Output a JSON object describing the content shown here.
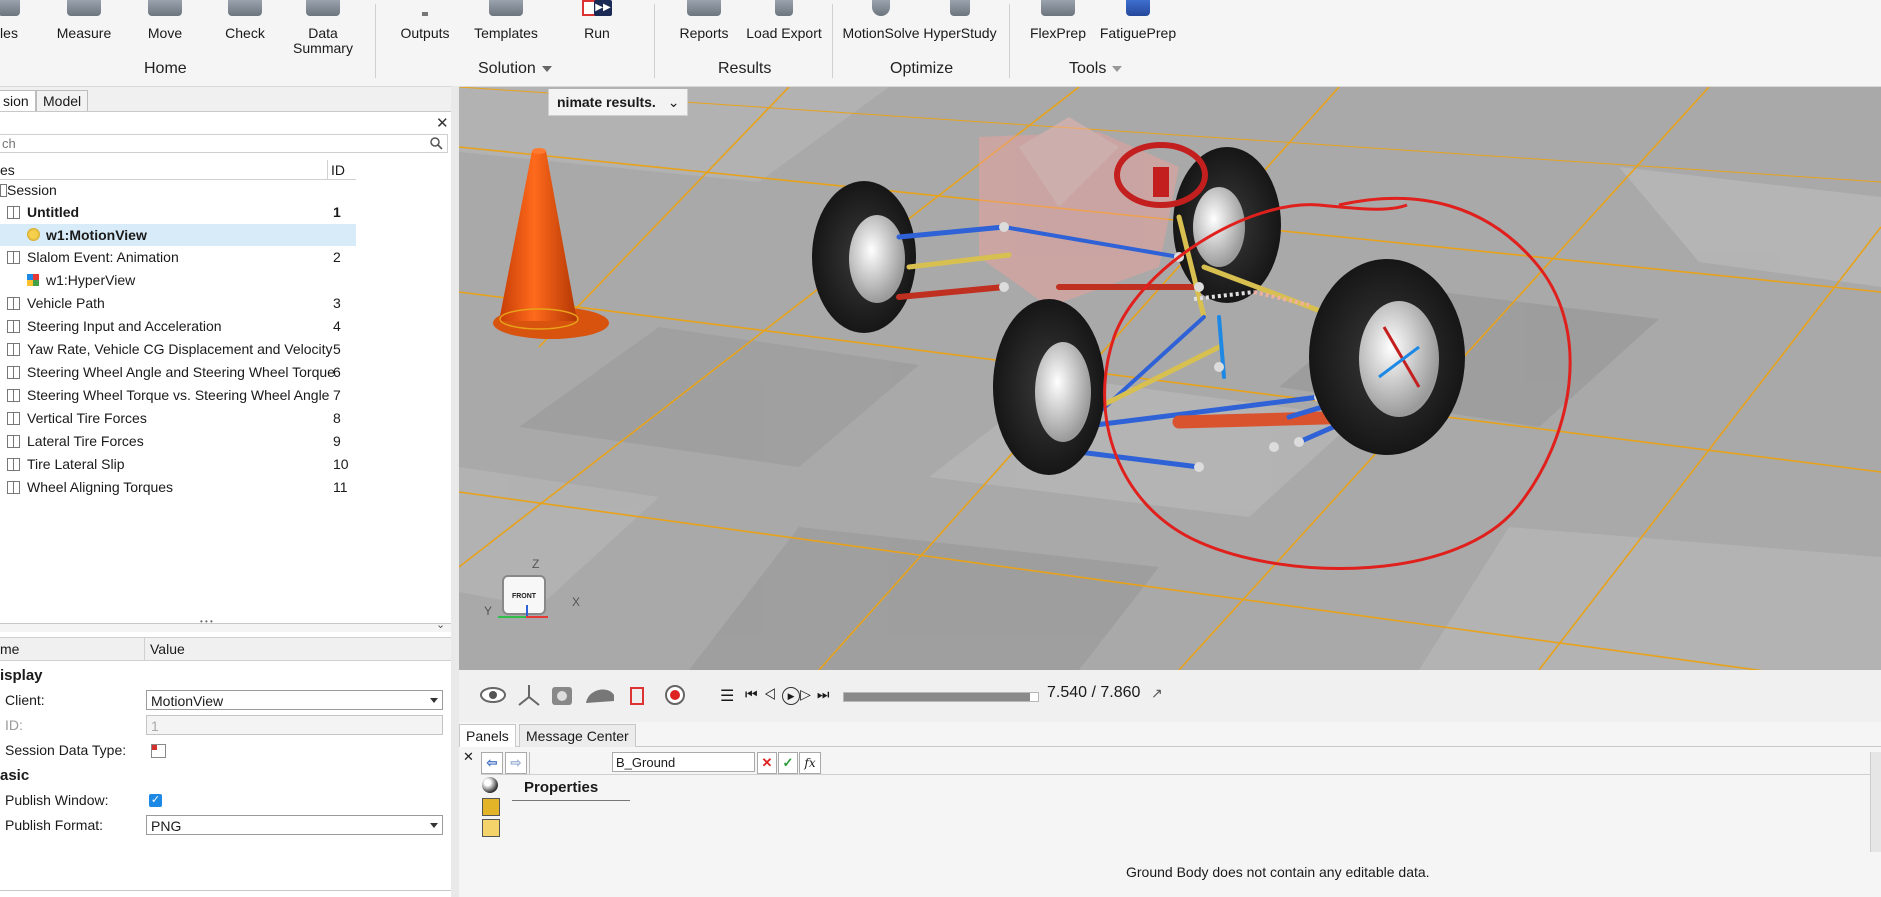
{
  "ribbon": {
    "buttons": [
      {
        "label": "les",
        "name": "files-button"
      },
      {
        "label": "Measure",
        "name": "measure-button"
      },
      {
        "label": "Move",
        "name": "move-button"
      },
      {
        "label": "Check",
        "name": "check-button"
      },
      {
        "label": "Data\nSummary",
        "name": "data-summary-button"
      },
      {
        "label": "Outputs",
        "name": "outputs-button"
      },
      {
        "label": "Templates",
        "name": "templates-button"
      },
      {
        "label": "Run",
        "name": "run-button"
      },
      {
        "label": "Reports",
        "name": "reports-button"
      },
      {
        "label": "Load Export",
        "name": "load-export-button"
      },
      {
        "label": "MotionSolve",
        "name": "motionsolve-button"
      },
      {
        "label": "HyperStudy",
        "name": "hyperstudy-button"
      },
      {
        "label": "FlexPrep",
        "name": "flexprep-button"
      },
      {
        "label": "FatiguePrep",
        "name": "fatigueprep-button"
      }
    ],
    "groups": {
      "home": "Home",
      "solution": "Solution",
      "results": "Results",
      "optimize": "Optimize",
      "tools": "Tools"
    }
  },
  "left_panel": {
    "tabs": {
      "session": "sion",
      "model": "Model"
    },
    "search_placeholder": "ch",
    "columns": {
      "name": "es",
      "id": "ID"
    },
    "tree": {
      "root": "Session",
      "items": [
        {
          "name": "Untitled",
          "id": "1"
        },
        {
          "name": "w1:MotionView",
          "id": ""
        },
        {
          "name": "Slalom Event: Animation",
          "id": "2"
        },
        {
          "name": "w1:HyperView",
          "id": ""
        },
        {
          "name": "Vehicle Path",
          "id": "3"
        },
        {
          "name": "Steering Input and Acceleration",
          "id": "4"
        },
        {
          "name": "Yaw Rate, Vehicle CG Displacement and Velocity",
          "id": "5"
        },
        {
          "name": "Steering Wheel Angle and Steering Wheel Torque",
          "id": "6"
        },
        {
          "name": "Steering Wheel Torque vs. Steering Wheel Angle",
          "id": "7"
        },
        {
          "name": "Vertical Tire Forces",
          "id": "8"
        },
        {
          "name": "Lateral Tire Forces",
          "id": "9"
        },
        {
          "name": "Tire Lateral Slip",
          "id": "10"
        },
        {
          "name": "Wheel Aligning Torques",
          "id": "11"
        }
      ]
    },
    "splitter_dots": "• • •",
    "props": {
      "header_name": "me",
      "header_value": "Value",
      "section_display": "isplay",
      "client_label": "Client:",
      "client_value": "MotionView",
      "id_label": "ID:",
      "id_value": "1",
      "session_data_type_label": "Session Data Type:",
      "section_basic": "asic",
      "publish_window_label": "Publish Window:",
      "publish_format_label": "Publish Format:",
      "publish_format_value": "PNG"
    }
  },
  "viewport": {
    "title_tab": "nimate results.",
    "cube_face": "FRONT",
    "axis_z": "Z",
    "axis_x": "X",
    "axis_y": "Y"
  },
  "animation": {
    "time": "7.540 / 7.860",
    "progress": 0.96
  },
  "bottom": {
    "tabs": {
      "panels": "Panels",
      "messages": "Message Center"
    },
    "entity_field": "B_Ground",
    "fx": "fx",
    "properties": "Properties",
    "message": "Ground Body does not contain any editable data."
  },
  "colors": {
    "accent_blue": "#1e88e5",
    "annotation_red": "#e0201d",
    "cone_orange": "#f05a14",
    "floor_line": "#e8a21a"
  }
}
